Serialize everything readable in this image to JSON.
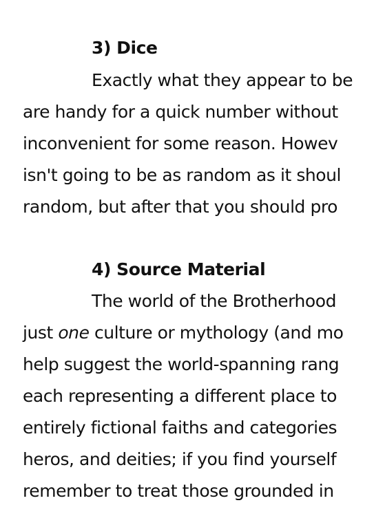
{
  "sections": [
    {
      "heading": "3) Dice",
      "lines": [
        "Exactly what they appear to be",
        "are handy for a quick number without",
        "inconvenient for some reason. Howev",
        "isn't going to be as random as it shoul",
        "random, but after that you should pro"
      ]
    },
    {
      "heading": "4) Source Material",
      "lines": [
        "The world of the Brotherhood",
        {
          "before": "just ",
          "em": "one",
          "after": " culture or mythology (and mo"
        },
        "help suggest the world-spanning rang",
        "each representing a different place to",
        "entirely fictional faiths and categories",
        "heros, and deities; if you find yourself",
        "remember to treat those grounded in"
      ]
    }
  ]
}
